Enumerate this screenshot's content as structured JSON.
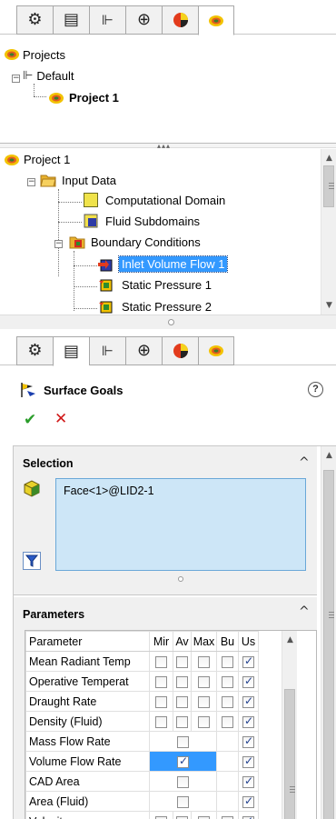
{
  "top_tabs": {
    "icons": [
      "feature-manager-icon",
      "property-manager-icon",
      "configuration-manager-icon",
      "dimxpert-icon",
      "display-manager-icon",
      "flow-simulation-icon"
    ]
  },
  "projects_tree": {
    "root_label": "Projects",
    "config_label": "Default",
    "project_label": "Project 1"
  },
  "analysis_tree": {
    "project_label": "Project 1",
    "input_data_label": "Input Data",
    "computational_domain_label": "Computational Domain",
    "fluid_subdomains_label": "Fluid Subdomains",
    "boundary_conditions_label": "Boundary Conditions",
    "bc_items": [
      "Inlet Volume Flow 1",
      "Static Pressure 1",
      "Static Pressure 2"
    ]
  },
  "property_manager": {
    "title": "Surface Goals",
    "help_icon": "help-icon",
    "ok_icon": "check-icon",
    "cancel_icon": "close-icon"
  },
  "selection": {
    "header": "Selection",
    "face_value": "Face<1>@LID2-1"
  },
  "parameters": {
    "header": "Parameters",
    "columns": [
      "Parameter",
      "Mir",
      "Av",
      "Max",
      "Bu",
      "Us"
    ],
    "rows": [
      {
        "name": "Mean Radiant Temp",
        "min": false,
        "avg": false,
        "max": false,
        "bulk": false,
        "use": true,
        "cells": "all"
      },
      {
        "name": "Operative Temperat",
        "min": false,
        "avg": false,
        "max": false,
        "bulk": false,
        "use": true,
        "cells": "all"
      },
      {
        "name": "Draught Rate",
        "min": false,
        "avg": false,
        "max": false,
        "bulk": false,
        "use": true,
        "cells": "all"
      },
      {
        "name": "Density (Fluid)",
        "min": false,
        "avg": false,
        "max": false,
        "bulk": false,
        "use": true,
        "cells": "all"
      },
      {
        "name": "Mass Flow Rate",
        "value": false,
        "use": true,
        "cells": "single"
      },
      {
        "name": "Volume Flow Rate",
        "value": true,
        "use": true,
        "cells": "single",
        "selected": true
      },
      {
        "name": "CAD Area",
        "value": false,
        "use": true,
        "cells": "single"
      },
      {
        "name": "Area (Fluid)",
        "value": false,
        "use": true,
        "cells": "single"
      },
      {
        "name": "Velocity",
        "min": false,
        "avg": false,
        "max": false,
        "bulk": false,
        "use": true,
        "cells": "all"
      }
    ]
  },
  "colors": {
    "selection_blue": "#3399ff",
    "selection_box_bg": "#cde6f7",
    "ok_green": "#2a9d2a",
    "cancel_red": "#d01818"
  }
}
